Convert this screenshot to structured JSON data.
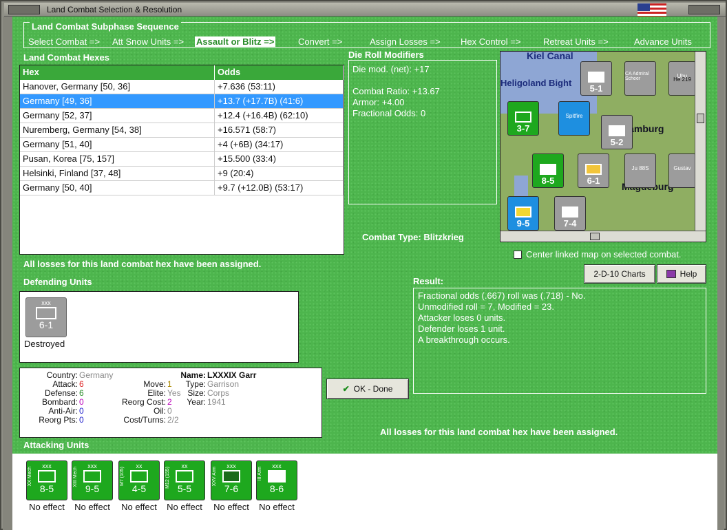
{
  "window": {
    "title": "Land Combat Selection & Resolution"
  },
  "subphase": {
    "header": "Land Combat Subphase Sequence",
    "steps": [
      "Select Combat =>",
      "Att Snow Units =>",
      "Assault or Blitz =>",
      "Convert =>",
      "Assign Losses =>",
      "Hex Control =>",
      "Retreat Units =>",
      "Advance Units"
    ],
    "active_index": 2
  },
  "hexes": {
    "label": "Land Combat Hexes",
    "col_hex": "Hex",
    "col_odds": "Odds",
    "rows": [
      {
        "hex": "Hanover, Germany [50, 36]",
        "odds": "+7.636 (53:11)"
      },
      {
        "hex": "Germany [49, 36]",
        "odds": "+13.7 (+17.7B) (41:6)"
      },
      {
        "hex": "Germany [52, 37]",
        "odds": "+12.4 (+16.4B) (62:10)"
      },
      {
        "hex": "Nuremberg, Germany [54, 38]",
        "odds": "+16.571 (58:7)"
      },
      {
        "hex": "Germany [51, 40]",
        "odds": "+4 (+6B) (34:17)"
      },
      {
        "hex": "Pusan, Korea [75, 157]",
        "odds": "+15.500 (33:4)"
      },
      {
        "hex": "Helsinki, Finland [37, 48]",
        "odds": "+9 (20:4)"
      },
      {
        "hex": "Germany [50, 40]",
        "odds": "+9.7 (+12.0B) (53:17)"
      }
    ],
    "selected_index": 1
  },
  "drm": {
    "label": "Die Roll Modifiers",
    "line1": "Die mod. (net): +17",
    "line2": "Combat Ratio: +13.67",
    "line3": "Armor: +4.00",
    "line4": "Fractional Odds: 0"
  },
  "map": {
    "cities": [
      "Kiel Canal",
      "Heligoland Bight",
      "Hamburg",
      "Magdeburg"
    ],
    "markers": [
      "Spitfire",
      "CA Admiral Scheer",
      "Ju 88S",
      "Gustav",
      "Uhu",
      "He 219"
    ]
  },
  "combat_type": {
    "label": "Combat Type:",
    "value": "Blitzkrieg"
  },
  "center_map": {
    "label": "Center linked map on selected combat."
  },
  "losses_msg": "All losses for this land combat hex have been assigned.",
  "buttons": {
    "charts": "2-D-10 Charts",
    "help": "Help",
    "ok": "OK - Done"
  },
  "defending": {
    "label": "Defending Units",
    "unit": {
      "size": "xxx",
      "name": "LXXXIX Garr",
      "strength": "6-1",
      "status": "Destroyed"
    }
  },
  "info": {
    "country_k": "Country:",
    "country_v": "Germany",
    "attack_k": "Attack:",
    "attack_v": "6",
    "defense_k": "Defense:",
    "defense_v": "6",
    "bombard_k": "Bombard:",
    "bombard_v": "0",
    "antiair_k": "Anti-Air:",
    "antiair_v": "0",
    "reorgpts_k": "Reorg Pts:",
    "reorgpts_v": "0",
    "move_k": "Move:",
    "move_v": "1",
    "elite_k": "Elite:",
    "elite_v": "Yes",
    "reorgcost_k": "Reorg Cost:",
    "reorgcost_v": "2",
    "oil_k": "Oil:",
    "oil_v": "0",
    "costturns_k": "Cost/Turns:",
    "costturns_v": "2/2",
    "name_k": "Name:",
    "name_v": "LXXXIX Garr",
    "type_k": "Type:",
    "type_v": "Garrison",
    "size_k": "Size:",
    "size_v": "Corps",
    "year_k": "Year:",
    "year_v": "1941"
  },
  "result": {
    "label": "Result:",
    "lines": [
      "Fractional odds (.667) roll was (.718)  - No.",
      "Unmodified roll = 7, Modified = 23.",
      "Attacker loses 0 units.",
      "Defender loses 1 unit.",
      "A breakthrough occurs."
    ]
  },
  "attacking": {
    "label": "Attacking Units",
    "units": [
      {
        "size": "xxx",
        "name": "XX Mech",
        "strength": "8-5",
        "effect": "No effect"
      },
      {
        "size": "xxx",
        "name": "XIII Mech",
        "strength": "9-5",
        "effect": "No effect"
      },
      {
        "size": "xx",
        "name": "M7 (105)",
        "strength": "4-5",
        "effect": "No effect"
      },
      {
        "size": "xx",
        "name": "M12 (155)",
        "strength": "5-5",
        "effect": "No effect"
      },
      {
        "size": "xxx",
        "name": "XXV Arm",
        "strength": "7-6",
        "effect": "No effect"
      },
      {
        "size": "xxx",
        "name": "III Arm",
        "strength": "8-6",
        "effect": "No effect"
      }
    ]
  }
}
